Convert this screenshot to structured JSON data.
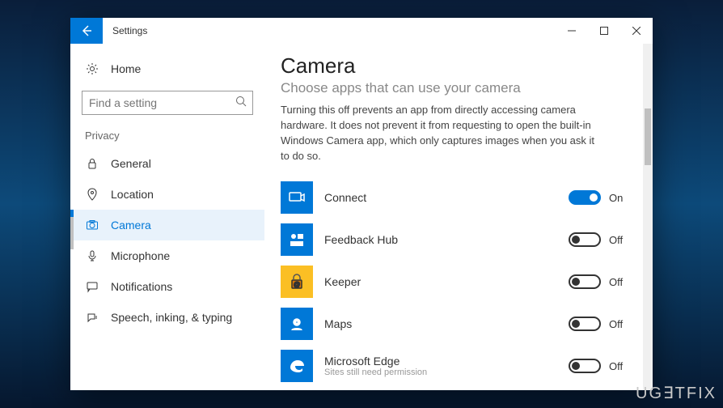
{
  "window": {
    "title": "Settings",
    "home_label": "Home",
    "search_placeholder": "Find a setting",
    "section_label": "Privacy"
  },
  "nav": [
    {
      "icon": "lock",
      "label": "General"
    },
    {
      "icon": "location",
      "label": "Location"
    },
    {
      "icon": "camera",
      "label": "Camera",
      "active": true
    },
    {
      "icon": "mic",
      "label": "Microphone"
    },
    {
      "icon": "notif",
      "label": "Notifications"
    },
    {
      "icon": "speech",
      "label": "Speech, inking, & typing"
    }
  ],
  "page": {
    "title": "Camera",
    "sub_heading": "Choose apps that can use your camera",
    "description": "Turning this off prevents an app from directly accessing camera hardware. It does not prevent it from requesting to open the built-in Windows Camera app, which only captures images when you ask it to do so."
  },
  "apps": [
    {
      "name": "Connect",
      "icon": "connect",
      "on": true,
      "state": "On"
    },
    {
      "name": "Feedback Hub",
      "icon": "feedback",
      "on": false,
      "state": "Off"
    },
    {
      "name": "Keeper",
      "icon": "keeper",
      "on": false,
      "state": "Off"
    },
    {
      "name": "Maps",
      "icon": "maps",
      "on": false,
      "state": "Off"
    },
    {
      "name": "Microsoft Edge",
      "icon": "edge",
      "on": false,
      "state": "Off",
      "sub": "Sites still need permission"
    }
  ],
  "watermark": "UG∃TFIX"
}
